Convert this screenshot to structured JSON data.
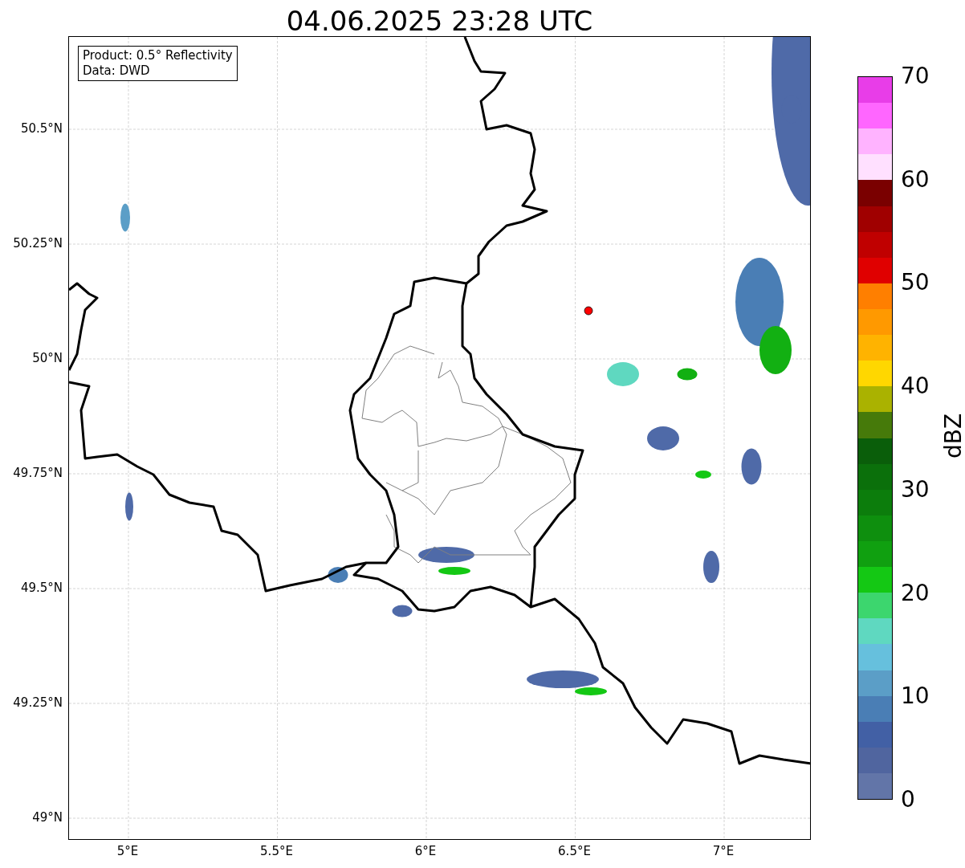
{
  "title": "04.06.2025 23:28 UTC",
  "info_box": [
    "Product: 0.5° Reflectivity",
    "Data: DWD"
  ],
  "map": {
    "y_ticks": [
      "50.5°N",
      "50.25°N",
      "50°N",
      "49.75°N",
      "49.5°N",
      "49.25°N",
      "49°N"
    ],
    "x_ticks": [
      "5°E",
      "5.5°E",
      "6°E",
      "6.5°E",
      "7°E"
    ]
  },
  "colorbar": {
    "label": "dBZ",
    "ticks": [
      "70",
      "60",
      "50",
      "40",
      "30",
      "20",
      "10",
      "0"
    ],
    "bands": [
      {
        "color": "#e83de8"
      },
      {
        "color": "#ff66ff"
      },
      {
        "color": "#ffb3ff"
      },
      {
        "color": "#ffe0ff"
      },
      {
        "color": "#7a0000"
      },
      {
        "color": "#a00000"
      },
      {
        "color": "#c00000"
      },
      {
        "color": "#e00000"
      },
      {
        "color": "#ff7f00"
      },
      {
        "color": "#ff9900"
      },
      {
        "color": "#ffb300"
      },
      {
        "color": "#ffd700"
      },
      {
        "color": "#aab200"
      },
      {
        "color": "#467a0a"
      },
      {
        "color": "#0a5e0a"
      },
      {
        "color": "#0b700b"
      },
      {
        "color": "#0c7d0c"
      },
      {
        "color": "#0e8f0e"
      },
      {
        "color": "#10a010"
      },
      {
        "color": "#14c814"
      },
      {
        "color": "#3cd66e"
      },
      {
        "color": "#5fd8c0"
      },
      {
        "color": "#66c0dd"
      },
      {
        "color": "#5b9ec7"
      },
      {
        "color": "#4a7eb5"
      },
      {
        "color": "#4260a5"
      },
      {
        "color": "#50659f"
      },
      {
        "color": "#6275a8"
      }
    ]
  }
}
